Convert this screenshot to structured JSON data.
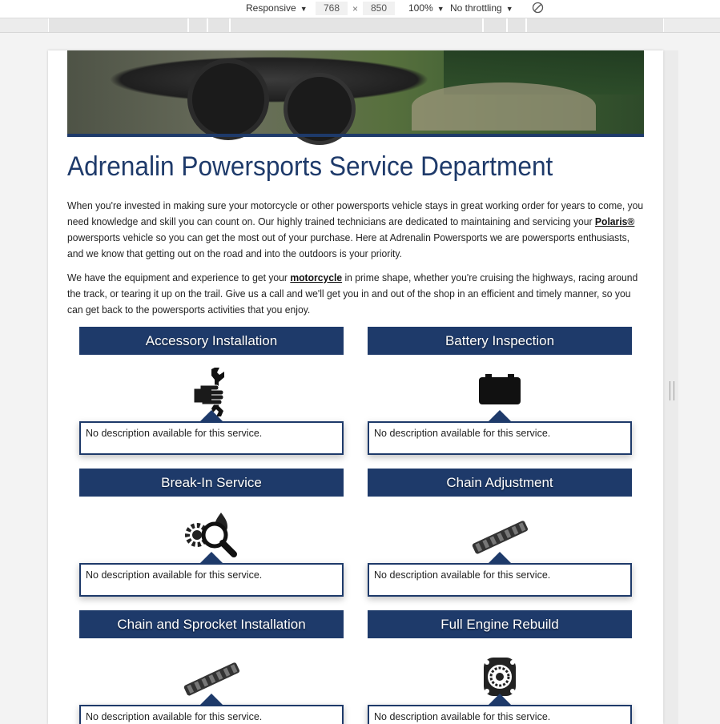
{
  "devtools": {
    "device": "Responsive",
    "width": "768",
    "height": "850",
    "zoom": "100%",
    "throttling": "No throttling",
    "times": "×"
  },
  "page": {
    "title": "Adrenalin Powersports Service Department",
    "para1_a": "When you're invested in making sure your motorcycle or other powersports vehicle stays in great working order for years to come, you need knowledge and skill you can count on. Our highly trained technicians are dedicated to maintaining and servicing your ",
    "para1_link": "Polaris®",
    "para1_b": " powersports vehicle so you can get the most out of your purchase. Here at Adrenalin Powersports we are powersports enthusiasts, and we know that getting out on the road and into the outdoors is your priority.",
    "para2_a": "We have the equipment and experience to get your ",
    "para2_link": "motorcycle",
    "para2_b": " in prime shape, whether you're cruising the highways, racing around the track, or tearing it up on the trail. Give us a call and we'll get you in and out of the shop in an efficient and timely manner, so you can get back to the powersports activities that you enjoy."
  },
  "services": [
    {
      "title": "Accessory Installation",
      "icon": "wrench-hand-icon",
      "desc": "No description available for this service."
    },
    {
      "title": "Battery Inspection",
      "icon": "battery-icon",
      "desc": "No description available for this service."
    },
    {
      "title": "Break-In Service",
      "icon": "gear-magnifier-icon",
      "desc": "No description available for this service."
    },
    {
      "title": "Chain Adjustment",
      "icon": "chain-icon",
      "desc": "No description available for this service."
    },
    {
      "title": "Chain and Sprocket Installation",
      "icon": "chain-icon",
      "desc": "No description available for this service."
    },
    {
      "title": "Full Engine Rebuild",
      "icon": "engine-icon",
      "desc": "No description available for this service."
    }
  ]
}
